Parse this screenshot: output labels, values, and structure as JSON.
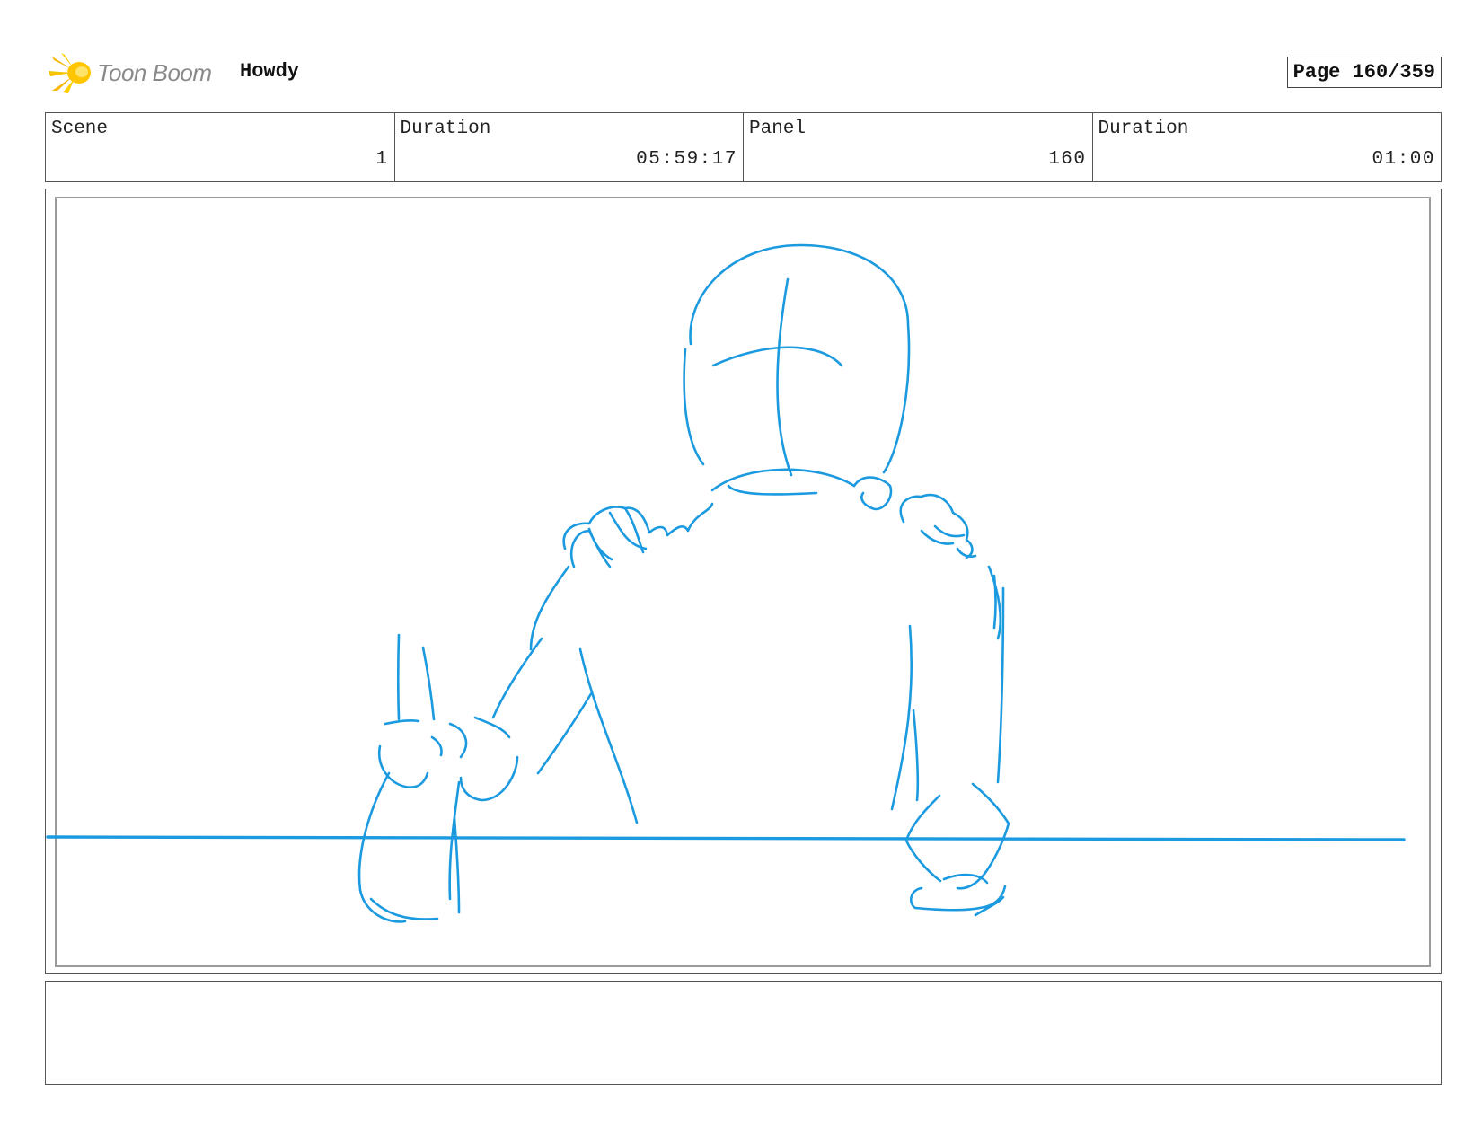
{
  "header": {
    "brand_name": "Toon Boom",
    "project_title": "Howdy",
    "page_label": "Page 160/359"
  },
  "info": {
    "scene_label": "Scene",
    "scene_value": "1",
    "scene_duration_label": "Duration",
    "scene_duration_value": "05:59:17",
    "panel_label": "Panel",
    "panel_value": "160",
    "panel_duration_label": "Duration",
    "panel_duration_value": "01:00"
  },
  "sketch": {
    "stroke_color": "#1b9ae0"
  },
  "notes": {
    "text": ""
  }
}
